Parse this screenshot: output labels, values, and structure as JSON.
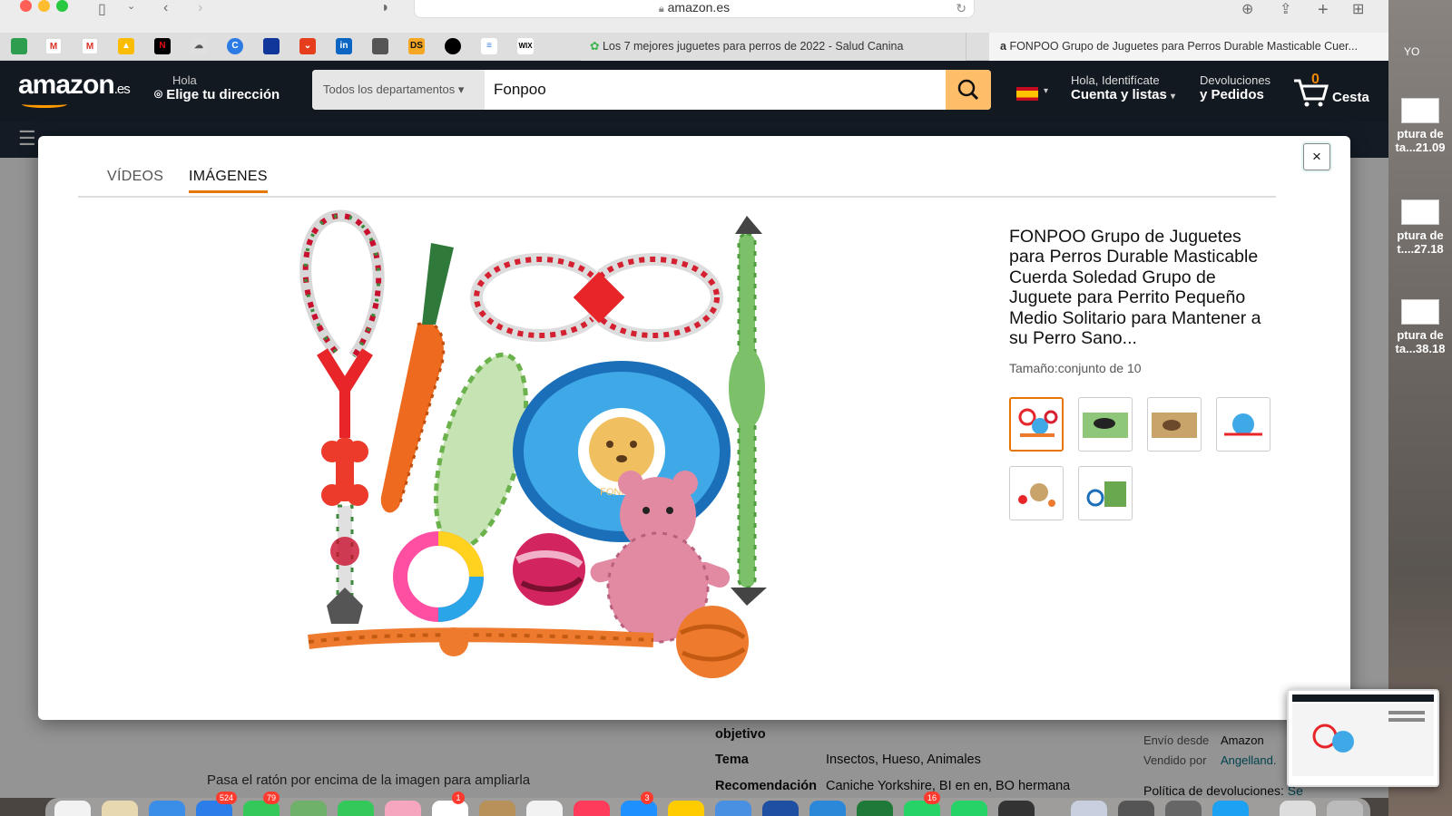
{
  "browser": {
    "url": "amazon.es",
    "tabs": [
      {
        "title": "Los 7 mejores juguetes para perros de 2022 - Salud Canina"
      },
      {
        "title": "FONPOO Grupo de Juguetes para Perros Durable Masticable Cuer..."
      }
    ],
    "bookmarks": [
      "gmail-icon",
      "drive-icon",
      "netflix-icon",
      "linkedin-icon",
      "ds-icon",
      "wix-icon"
    ],
    "bookmark_labels": {
      "ds": "DS",
      "wix": "WIX",
      "linkedin": "in"
    }
  },
  "header": {
    "logo": "amazon",
    "logo_suffix": ".es",
    "address_greeting": "Hola",
    "address_label": "Elige tu dirección",
    "search_department": "Todos los departamentos",
    "search_value": "Fonpoo",
    "account_greeting": "Hola, Identifícate",
    "account_label": "Cuenta y listas",
    "returns_line1": "Devoluciones",
    "returns_line2": "y Pedidos",
    "cart_count": "0",
    "cart_label": "Cesta"
  },
  "modal": {
    "tabs": [
      "VÍDEOS",
      "IMÁGENES"
    ],
    "active_tab": "IMÁGENES",
    "close_label": "×",
    "product_title": "FONPOO Grupo de Juguetes para Perros Durable Masticable Cuerda Soledad Grupo de Juguete para Perrito Pequeño Medio Solitario para Mantener a su Perro Sano...",
    "size_label": "Tamaño:conjunto de 10",
    "image_label": "FONPOO",
    "thumbnail_count": 6,
    "selected_thumbnail": 0
  },
  "page_under": {
    "hover_hint": "Pasa el ratón por encima de la imagen para ampliarla",
    "spec_rows": [
      {
        "label": "objetivo",
        "value": ""
      },
      {
        "label": "Tema",
        "value": "Insectos, Hueso, Animales"
      },
      {
        "label": "Recomendación",
        "value": "Caniche Yorkshire, BI en en, BO hermana"
      }
    ],
    "shipping_label": "Envío desde",
    "shipping_value": "Amazon",
    "sold_by_label": "Vendido por",
    "sold_by_value": "Angelland.",
    "return_policy": "Política de devoluciones:",
    "return_policy_link": "Se"
  },
  "desktop": {
    "user_label": "YO",
    "files": [
      {
        "name_line1": "ptura de",
        "name_line2": "ta...21.09"
      },
      {
        "name_line1": "ptura de",
        "name_line2": "t....27.18"
      },
      {
        "name_line1": "ptura de",
        "name_line2": "ta...38.18"
      }
    ]
  },
  "dock": {
    "badges": [
      "524",
      "79",
      "1",
      "3",
      "16"
    ]
  },
  "colors": {
    "amazon_nav": "#131921",
    "amazon_orange": "#e77600",
    "search_button": "#febd69",
    "cart_count": "#f08804"
  }
}
